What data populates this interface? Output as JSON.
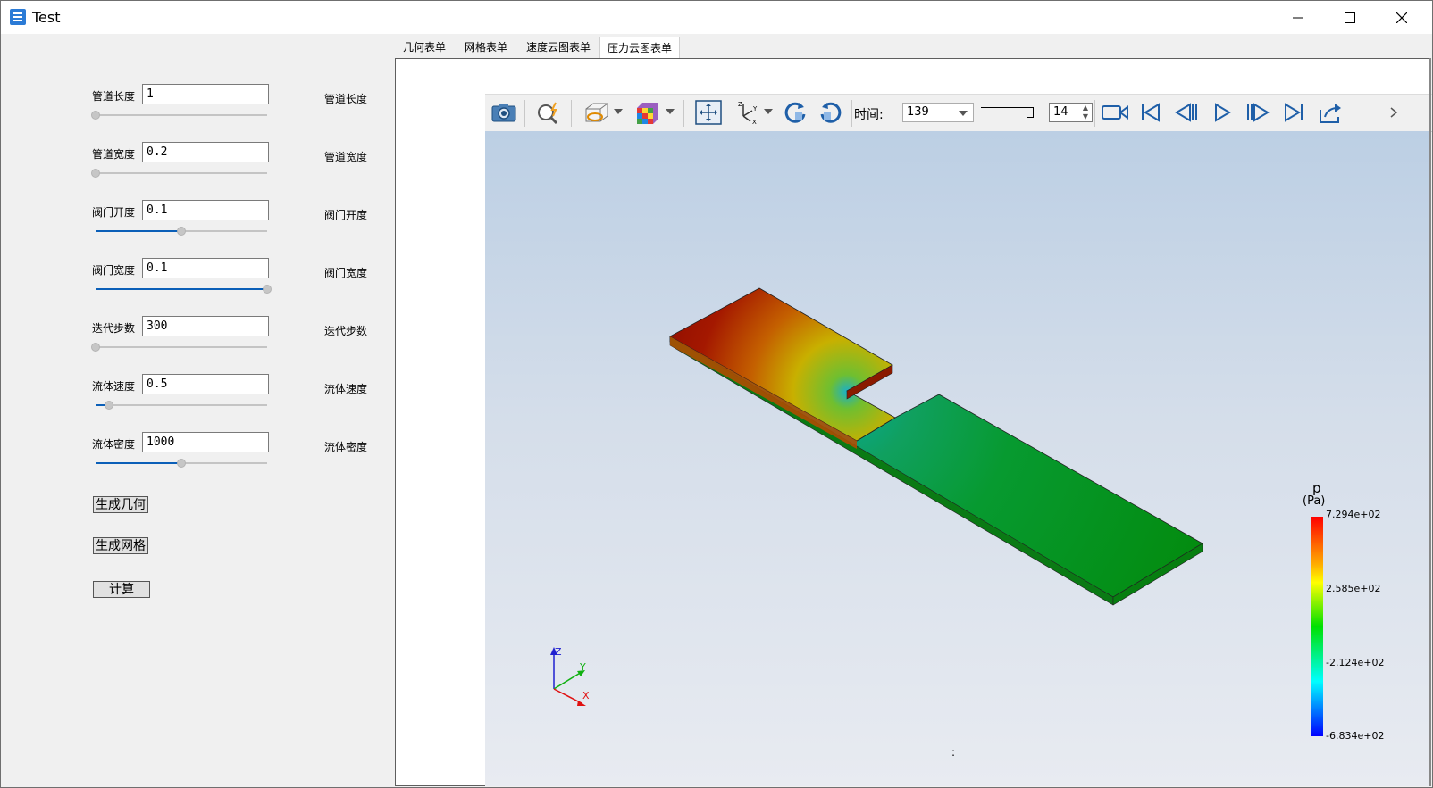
{
  "window": {
    "title": "Test",
    "controls": {
      "minimize": "minimize-icon",
      "maximize": "maximize-icon",
      "close": "close-icon"
    }
  },
  "form": {
    "fields": [
      {
        "label": "管道长度",
        "value": "1",
        "right_label": "管道长度",
        "slider_fraction": 0.0
      },
      {
        "label": "管道宽度",
        "value": "0.2",
        "right_label": "管道宽度",
        "slider_fraction": 0.0
      },
      {
        "label": "阀门开度",
        "value": "0.1",
        "right_label": "阀门开度",
        "slider_fraction": 0.5
      },
      {
        "label": "阀门宽度",
        "value": "0.1",
        "right_label": "阀门宽度",
        "slider_fraction": 1.0
      },
      {
        "label": "迭代步数",
        "value": "300",
        "right_label": "迭代步数",
        "slider_fraction": 0.0
      },
      {
        "label": "流体速度",
        "value": "0.5",
        "right_label": "流体速度",
        "slider_fraction": 0.08
      },
      {
        "label": "流体密度",
        "value": "1000",
        "right_label": "流体密度",
        "slider_fraction": 0.5
      }
    ],
    "buttons": {
      "geometry": "生成几何",
      "mesh": "生成网格",
      "compute": "计算"
    }
  },
  "tabs": [
    {
      "label": "几何表单",
      "active": false
    },
    {
      "label": "网格表单",
      "active": false
    },
    {
      "label": "速度云图表单",
      "active": false
    },
    {
      "label": "压力云图表单",
      "active": true
    }
  ],
  "toolbar": {
    "time_label": "时间:",
    "time_value": "139",
    "step_value": "14",
    "icons": [
      "camera-icon",
      "zoom-icon",
      "display-mode-icon",
      "color-map-icon",
      "reset-view-icon",
      "axes-icon",
      "rotate-cw-icon",
      "rotate-ccw-icon",
      "record-icon",
      "first-frame-icon",
      "prev-frame-icon",
      "play-icon",
      "next-frame-icon",
      "last-frame-icon",
      "export-icon"
    ]
  },
  "viewport": {
    "colorbar": {
      "title": "p",
      "unit": "(Pa)",
      "ticks": [
        "7.294e+02",
        "2.585e+02",
        "-2.124e+02",
        "-6.834e+02"
      ]
    },
    "axes": {
      "x": "X",
      "y": "Y",
      "z": "Z"
    },
    "status_text": ":"
  }
}
